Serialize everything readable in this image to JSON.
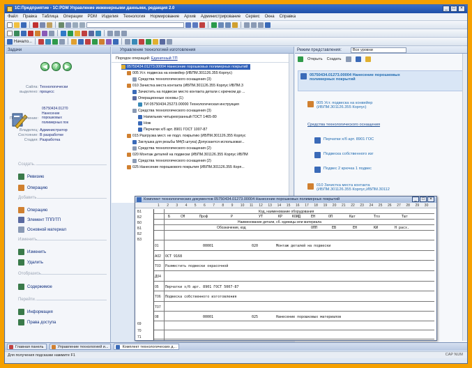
{
  "window": {
    "title": "1С:Предприятие - 1С:PDM Управление инженерными данными, редакция 2.0",
    "min": "_",
    "max": "□",
    "close": "×"
  },
  "menu": [
    "Файл",
    "Правка",
    "Таблица",
    "Операции",
    "PDM",
    "Изделия",
    "Технология",
    "Нормирование",
    "Архив",
    "Администрирование",
    "Сервис",
    "Окна",
    "Справка"
  ],
  "toolbar3": {
    "start_label": "Начало..."
  },
  "left": {
    "header": "Задачи",
    "nav": [
      "◀",
      "?",
      "▶"
    ],
    "type_label": "Сайла:",
    "type_value": "Технологически",
    "sel_label": "выделено:",
    "sel_value": "процесс",
    "designation_label": "Представление:",
    "designation_value": "05750434.01270",
    "designation_lines": [
      "Нанесение",
      "порошковых",
      "полимерных пок"
    ],
    "author_label": "Владелец:",
    "author_value": "Администратор",
    "state_label": "Состояние:",
    "state_value": "В разработке",
    "stage_label": "Стадия:",
    "stage_value": "Разработка",
    "sec_create": "Создать...",
    "create_items": [
      "Ревизию",
      "Операцию"
    ],
    "sec_add": "Добавить...",
    "add_items": [
      "Операцию",
      "Элемент ТПП/ТП",
      "Основной материал"
    ],
    "sec_change": "Изменить...",
    "change_items": [
      "Изменить",
      "Удалить"
    ],
    "sec_show": "Отобразить...",
    "show_items": [
      "Содержимое"
    ],
    "sec_go": "Перейти...",
    "go_items": [
      "Информация",
      "Права доступа"
    ]
  },
  "mid": {
    "header": "Управление технологией изготовления",
    "mode_label": "Порядок операций:",
    "mode_value": "Единичный ТП",
    "rows": [
      "05750434.01273.00004 Нанесение порошковых полимерных покрытий",
      "005 Уст. подвеска на конвейер (ИБПМ.301126.355 Корпус)",
      "Средства технологического оснащения (3)",
      "010 Зачистка места контакта (ИБПМ.301126.355 Корпус ИБПМ.3",
      "Зачистить на подвеске место контакта детали с крючком до ...",
      "Операционные основы (1)",
      "ТИ 05750434.25273.00000 Технологическая инструкция",
      "Средства технологического оснащения (3)",
      "Напильник четырехгранный ГОСТ 1465-80",
      "Нож",
      "Перчатки х/б арт. 8901 ГОСТ 1007-87",
      "015 Разгрузка мест. не подл. покрытию (ИБПМ.301126.355 Корпус",
      "Заглушка для резьбы М4(5 штука) Допускается использоват...",
      "Средства технологического оснащения (2)",
      "020 Монтаж деталей на подвески (ИБПМ.301126.355 Корпус ИБПМ",
      "Средства технологического оснащения (2)",
      "025 Нанесение порошкового покрытия (ИБПМ.301126.355 Корп..."
    ]
  },
  "right": {
    "mode_label": "Режим представления:",
    "mode_value": "Все уровни",
    "open_label": "Открыть",
    "create_label": "Создать",
    "title_line1": "05750434.01273.00004 Нанесение порошковых",
    "title_line2": "полимерных покрытий",
    "op1_line1": "005 Уст. подвеска на конвейер",
    "op1_line2": "(ИБПМ.301126.355 Корпус)",
    "equip_label": "Средства технологического оснащения",
    "equip1": "Перчатки х/б арт. 8901 ГОС",
    "equip2": "Подвеска собственного изг",
    "equip3": "Подвес 2 крючка 1 подвес",
    "op2_line1": "010 Зачистка места контакта",
    "op2_line2": "(ИБПМ.301126.355 Корпус,ИБПМ.30112"
  },
  "doc": {
    "title": "Комплект технологических документов 05750434.01273.00004 Нанесение порошковых полимерных покрытий",
    "ruler": [
      "1",
      "2",
      "3",
      "4",
      "5",
      "6",
      "7",
      "8",
      "9",
      "10",
      "11",
      "12",
      "13",
      "14",
      "15",
      "16",
      "17",
      "18",
      "19",
      "20",
      "21",
      "22",
      "23",
      "24",
      "25",
      "26",
      "27",
      "28",
      "29",
      "30"
    ],
    "lines": [
      "Б1",
      "Б2",
      "Б0",
      "Б1",
      "Б2",
      "Б3",
      "01",
      "А02",
      "Т03",
      "Д04",
      "05",
      "Т06",
      "Т07",
      "08",
      "69",
      "70",
      "71"
    ],
    "head1": "Код, наименование оборудования",
    "head2": [
      "Б",
      "СМ",
      "Проф",
      "Р",
      "УТ",
      "КР",
      "КОИД",
      "ЕН",
      "ОП",
      "Кшт",
      "Тпз",
      "Тшт"
    ],
    "head3": "Наименование детали, сб. единицы или материала",
    "head4": [
      "Обозначение, код",
      "ОПП",
      "ЕВ",
      "ЕН",
      "КИ",
      "Н расх."
    ],
    "row_a02": [
      "00001",
      "020",
      "Монтаж деталей на подвески"
    ],
    "row_t03": "ОСТ 9168",
    "row_d04": "Разместить подвески окрасочной",
    "row_t06": "Перчатки х/б арт. 8901 ГОСТ 5007-87",
    "row_t07": "Подвеска собственного изготовления",
    "row_a09": [
      "00001",
      "025",
      "Нанесение порошковых материалов"
    ]
  },
  "taskbar": [
    "Главная панель",
    "Управление технологией и...",
    "Комплект технологических д..."
  ],
  "status": {
    "hint": "Для получения подсказки нажмите F1",
    "caps": "CAP",
    "num": "NUM"
  }
}
